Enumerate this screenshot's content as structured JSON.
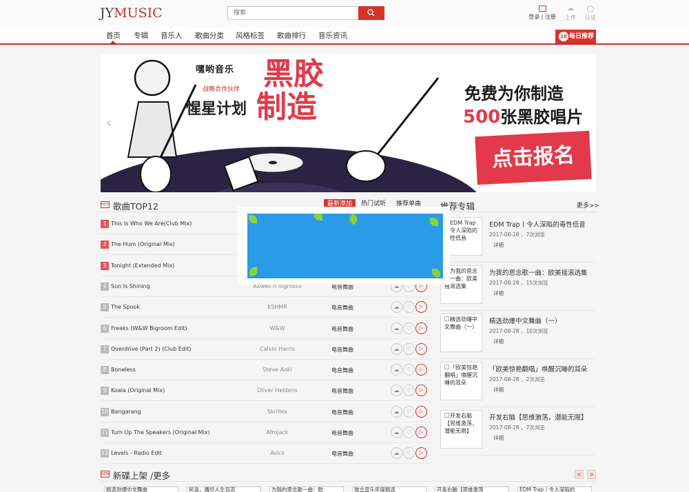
{
  "header": {
    "logo_jy": "JY",
    "logo_music": "MUSIC",
    "search_placeholder": "搜索",
    "login_label": "登录 | 注册",
    "upload_label": "上传",
    "recognize_label": "认证"
  },
  "nav": {
    "items": [
      "首页",
      "专辑",
      "音乐人",
      "歌曲分类",
      "风格标签",
      "歌曲排行",
      "音乐资讯"
    ],
    "daily_badge": "10",
    "daily_label": "每日推荐"
  },
  "banner": {
    "brand_name": "嘿哟音乐",
    "partner": "战略合作伙伴",
    "sponsor": "惺星计划",
    "title_1": "黑胶",
    "title_2": "制造",
    "free_text": "免费为你制造",
    "count_text": "500",
    "count_suffix": "张黑胶唱片",
    "cta": "点击报名"
  },
  "songs_section": {
    "icon_text": "HOT",
    "title": "歌曲TOP12",
    "tabs": [
      "最新添加",
      "热门试听",
      "推荐单曲"
    ],
    "songs": [
      {
        "rank": "1",
        "name": "This Is Who We Are(Club Mix)",
        "artist": "",
        "genre": ""
      },
      {
        "rank": "2",
        "name": "The Hum (Original Mix)",
        "artist": "",
        "genre": ""
      },
      {
        "rank": "3",
        "name": "Tonight (Extended Mix)",
        "artist": "",
        "genre": ""
      },
      {
        "rank": "4",
        "name": "Sun Is Shining",
        "artist": "Axwell Λ Ingrosso",
        "genre": "电音舞曲"
      },
      {
        "rank": "5",
        "name": "The Spook",
        "artist": "KSHMR",
        "genre": "电音舞曲"
      },
      {
        "rank": "6",
        "name": "Freaks (W&W Bigroom Edit)",
        "artist": "W&W",
        "genre": "电音舞曲"
      },
      {
        "rank": "7",
        "name": "Overdrive (Part 2) (Club Edit)",
        "artist": "Calvin Harris",
        "genre": "电音舞曲"
      },
      {
        "rank": "8",
        "name": "Boneless",
        "artist": "Steve Aoki",
        "genre": "电音舞曲"
      },
      {
        "rank": "9",
        "name": "Koala (Original Mix)",
        "artist": "Oliver Heldens",
        "genre": "电音舞曲"
      },
      {
        "rank": "10",
        "name": "Bangarang",
        "artist": "Skrillex",
        "genre": "电音舞曲"
      },
      {
        "rank": "11",
        "name": "Turn Up The Speakers (Original Mix)",
        "artist": "Afrojack",
        "genre": "电音舞曲"
      },
      {
        "rank": "12",
        "name": "Levels - Radio Edit",
        "artist": "Avicii",
        "genre": "电音舞曲"
      }
    ]
  },
  "albums_section": {
    "title": "推荐专辑",
    "more": "更多>>",
    "albums": [
      {
        "cover": "EDM Trap丨令人深陷的毒性低音",
        "title": "EDM Trap丨令人深陷的毒性低音",
        "meta": "2017-08-28 ，7次浏览",
        "detail": "详细"
      },
      {
        "cover": "为我的思念歌一曲：欧美摇滚选集",
        "title": "为我的思念歌一曲：欧美摇滚选集",
        "meta": "2017-08-28 ，15次浏览",
        "detail": "详细"
      },
      {
        "cover": "精选劲爆中文舞曲（一）",
        "title": "精选劲爆中文舞曲（一）",
        "meta": "2017-08-28 ，10次浏览",
        "detail": "详细"
      },
      {
        "cover": "「欧美惊艳翻唱」唤醒沉睡的耳朵",
        "title": "「欧美惊艳翻唱」唤醒沉睡的耳朵",
        "meta": "2017-08-28 ，2次浏览",
        "detail": "详细"
      },
      {
        "cover": "开发右脑【思维激荡，潜能无限】",
        "title": "开发右脑【思维激荡，潜能无限】",
        "meta": "2017-08-28 ，7次浏览",
        "detail": "详细"
      }
    ]
  },
  "new_section": {
    "icon_text": "NEW",
    "title": "新碟上架 /更多",
    "prev": "<",
    "next": ">",
    "cards": [
      "精选劲爆中文舞曲",
      "民谣，播尽人生百态",
      "为我的思念歌一曲：欧",
      "独立音乐年度精选",
      "开发右脑【思维激荡",
      "EDM Trap丨令人深陷的"
    ]
  }
}
